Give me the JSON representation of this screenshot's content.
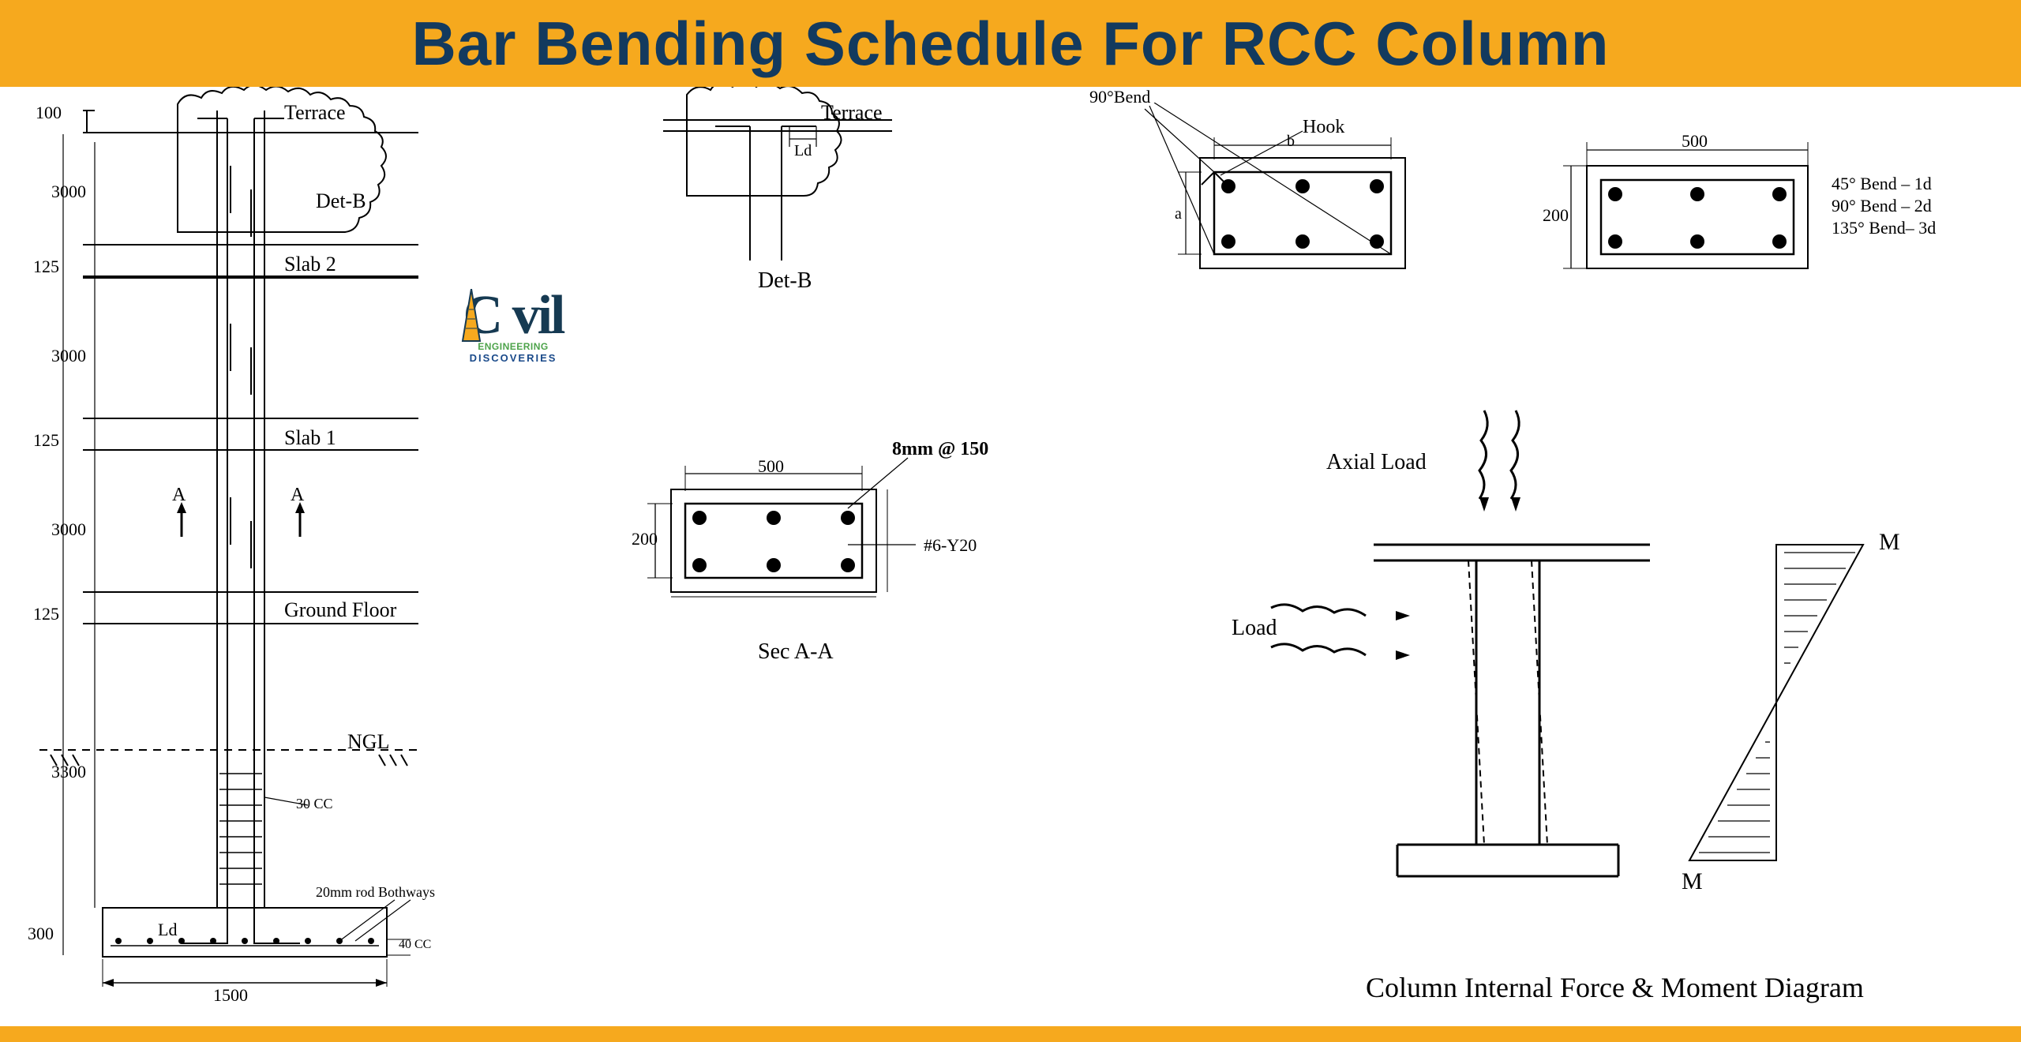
{
  "header": {
    "title": "Bar Bending Schedule For RCC Column"
  },
  "footer_color": "#f6a91e",
  "colors": {
    "accent": "#f6a91e",
    "navy": "#133a5e",
    "ink": "#000000"
  },
  "logo": {
    "brand": "C  vil",
    "sub_green": "ENGINEERING",
    "sub_blue": "DISCOVERIES"
  },
  "elevation": {
    "labels": {
      "terrace": "Terrace",
      "det_b": "Det-B",
      "slab2": "Slab 2",
      "slab1": "Slab 1",
      "ground_floor": "Ground Floor",
      "ngl": "NGL",
      "ld": "Ld",
      "sec_mark_a": "A",
      "cover_side": "30 CC",
      "cover_bottom": "40 CC",
      "rebar_note": "20mm rod Bothways"
    },
    "dims": {
      "top_overhang": "100",
      "span_top": "3000",
      "slab2_thk": "125",
      "span_slab2": "3000",
      "slab1_thk": "125",
      "span_slab1": "3000",
      "gf_thk": "125",
      "below_gf": "3300",
      "footing_thk": "300",
      "footing_width": "1500"
    }
  },
  "det_b_view": {
    "labels": {
      "terrace": "Terrace",
      "ld": "Ld",
      "caption": "Det-B"
    }
  },
  "section_aa": {
    "caption": "Sec A-A",
    "width": "500",
    "height": "200",
    "stirrup_note": "8mm @ 150",
    "rebar_note": "#6-Y20"
  },
  "hook_detail": {
    "caption_hook": "Hook",
    "bend_label": "90°Bend",
    "dim_a": "a",
    "dim_b": "b"
  },
  "dim_section": {
    "width": "500",
    "height": "200",
    "bend_notes": {
      "r1": "45° Bend – 1d",
      "r2": "90° Bend – 2d",
      "r3": "135° Bend– 3d"
    }
  },
  "force_diagram": {
    "caption": "Column Internal Force & Moment Diagram",
    "axial_label": "Axial Load",
    "lateral_label": "Load",
    "moment_top": "M",
    "moment_bot": "M"
  }
}
